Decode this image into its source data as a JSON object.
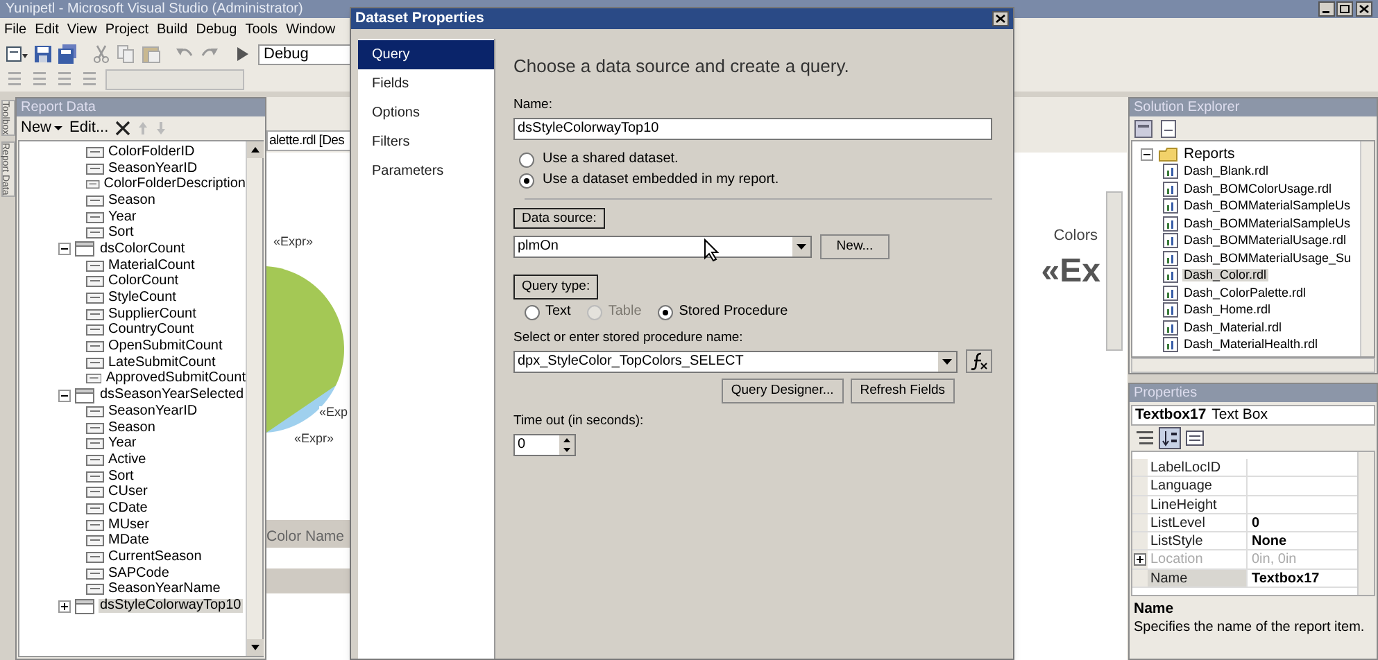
{
  "window": {
    "title": "Yunipetl - Microsoft Visual Studio (Administrator)"
  },
  "menu": [
    "File",
    "Edit",
    "View",
    "Project",
    "Build",
    "Debug",
    "Tools",
    "Window"
  ],
  "toolbar": {
    "configuration": "Debug"
  },
  "side_tabs": [
    "Toolbox",
    "Report Data"
  ],
  "report_data": {
    "title": "Report Data",
    "new_button": "New",
    "edit_button": "Edit...",
    "tree": [
      {
        "kind": "field",
        "label": "ColorFolderID"
      },
      {
        "kind": "field",
        "label": "SeasonYearID"
      },
      {
        "kind": "field",
        "label": "ColorFolderDescription"
      },
      {
        "kind": "field",
        "label": "Season"
      },
      {
        "kind": "field",
        "label": "Year"
      },
      {
        "kind": "field",
        "label": "Sort"
      },
      {
        "kind": "dataset",
        "label": "dsColorCount",
        "expanded": true,
        "selected": false,
        "children": [
          {
            "kind": "field",
            "label": "MaterialCount"
          },
          {
            "kind": "field",
            "label": "ColorCount"
          },
          {
            "kind": "field",
            "label": "StyleCount"
          },
          {
            "kind": "field",
            "label": "SupplierCount"
          },
          {
            "kind": "field",
            "label": "CountryCount"
          },
          {
            "kind": "field",
            "label": "OpenSubmitCount"
          },
          {
            "kind": "field",
            "label": "LateSubmitCount"
          },
          {
            "kind": "field",
            "label": "ApprovedSubmitCount"
          }
        ]
      },
      {
        "kind": "dataset",
        "label": "dsSeasonYearSelected",
        "expanded": true,
        "selected": false,
        "children": [
          {
            "kind": "field",
            "label": "SeasonYearID"
          },
          {
            "kind": "field",
            "label": "Season"
          },
          {
            "kind": "field",
            "label": "Year"
          },
          {
            "kind": "field",
            "label": "Active"
          },
          {
            "kind": "field",
            "label": "Sort"
          },
          {
            "kind": "field",
            "label": "CUser"
          },
          {
            "kind": "field",
            "label": "CDate"
          },
          {
            "kind": "field",
            "label": "MUser"
          },
          {
            "kind": "field",
            "label": "MDate"
          },
          {
            "kind": "field",
            "label": "CurrentSeason"
          },
          {
            "kind": "field",
            "label": "SAPCode"
          },
          {
            "kind": "field",
            "label": "SeasonYearName"
          }
        ]
      },
      {
        "kind": "dataset",
        "label": "dsStyleColorwayTop10",
        "expanded": false,
        "selected": true
      }
    ]
  },
  "designer": {
    "tab": "alette.rdl [Des",
    "labels": [
      "«Expr»",
      "«Exp",
      "«Expr»"
    ],
    "column_header": "Color Name",
    "heading": "Colors",
    "big_expr": "«Ex"
  },
  "dialog": {
    "title": "Dataset Properties",
    "nav": [
      {
        "label": "Query",
        "selected": true
      },
      {
        "label": "Fields",
        "selected": false
      },
      {
        "label": "Options",
        "selected": false
      },
      {
        "label": "Filters",
        "selected": false
      },
      {
        "label": "Parameters",
        "selected": false
      }
    ],
    "heading": "Choose a data source and create a query.",
    "name_label": "Name:",
    "name_value": "dsStyleColorwayTop10",
    "dataset_options": [
      {
        "label": "Use a shared dataset.",
        "selected": false
      },
      {
        "label": "Use a dataset embedded in my report.",
        "selected": true
      }
    ],
    "data_source_label": "Data source:",
    "data_source_value": "plmOn",
    "new_button": "New...",
    "query_type_label": "Query type:",
    "query_types": [
      {
        "label": "Text",
        "selected": false,
        "disabled": false
      },
      {
        "label": "Table",
        "selected": false,
        "disabled": true
      },
      {
        "label": "Stored Procedure",
        "selected": true,
        "disabled": false
      }
    ],
    "procedure_label": "Select or enter stored procedure name:",
    "procedure_value": "dpx_StyleColor_TopColors_SELECT",
    "buttons": [
      "Query Designer...",
      "Refresh Fields"
    ],
    "timeout_label": "Time out (in seconds):",
    "timeout_value": "0"
  },
  "solution_explorer": {
    "title": "Solution Explorer",
    "folder": {
      "label": "Reports",
      "expanded": true
    },
    "items": [
      {
        "label": "Dash_Blank.rdl",
        "selected": false
      },
      {
        "label": "Dash_BOMColorUsage.rdl",
        "selected": false
      },
      {
        "label": "Dash_BOMMaterialSampleUs",
        "selected": false
      },
      {
        "label": "Dash_BOMMaterialSampleUs",
        "selected": false
      },
      {
        "label": "Dash_BOMMaterialUsage.rdl",
        "selected": false
      },
      {
        "label": "Dash_BOMMaterialUsage_Su",
        "selected": false
      },
      {
        "label": "Dash_Color.rdl",
        "selected": true
      },
      {
        "label": "Dash_ColorPalette.rdl",
        "selected": false
      },
      {
        "label": "Dash_Home.rdl",
        "selected": false
      },
      {
        "label": "Dash_Material.rdl",
        "selected": false
      },
      {
        "label": "Dash_MaterialHealth.rdl",
        "selected": false
      }
    ]
  },
  "properties": {
    "title": "Properties",
    "object_name": "Textbox17",
    "object_type": "Text Box",
    "rows": [
      {
        "name": "LabelLocID",
        "disabled": false,
        "expandable": false,
        "selected": false
      },
      {
        "name": "Language",
        "disabled": false,
        "expandable": false,
        "selected": false
      },
      {
        "name": "LineHeight",
        "disabled": false,
        "expandable": false,
        "selected": false
      },
      {
        "name": "ListLevel",
        "value": "0",
        "modified": true,
        "disabled": false,
        "expandable": false,
        "selected": false
      },
      {
        "name": "ListStyle",
        "value": "None",
        "modified": true,
        "disabled": false,
        "expandable": false,
        "selected": false
      },
      {
        "name": "Location",
        "value": "0in, 0in",
        "modified": false,
        "disabled": true,
        "expandable": true,
        "selected": false
      },
      {
        "name": "Name",
        "value": "Textbox17",
        "modified": true,
        "disabled": false,
        "expandable": false,
        "selected": true
      }
    ],
    "description_title": "Name",
    "description": "Specifies the name of the report item."
  }
}
